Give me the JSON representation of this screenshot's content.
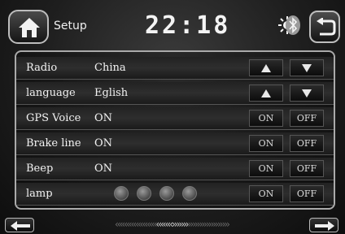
{
  "header": {
    "title": "Setup",
    "clock": "22:18",
    "icons": [
      "home-icon",
      "sun-icon",
      "bluetooth-icon",
      "back-icon"
    ]
  },
  "settings": {
    "rows": [
      {
        "label": "Radio",
        "value": "China",
        "control": "arrows"
      },
      {
        "label": "language",
        "value": "Eglish",
        "control": "arrows"
      },
      {
        "label": "GPS Voice",
        "value": "ON",
        "on_label": "ON",
        "off_label": "OFF"
      },
      {
        "label": "Brake line",
        "value": "ON",
        "on_label": "ON",
        "off_label": "OFF"
      },
      {
        "label": "Beep",
        "value": "ON",
        "on_label": "ON",
        "off_label": "OFF"
      },
      {
        "label": "lamp",
        "value": "",
        "on_label": "ON",
        "off_label": "OFF",
        "lamp_dots": 4
      }
    ]
  },
  "footer": {
    "scroll_left": "‹‹‹‹‹‹‹‹‹‹‹‹‹‹‹‹‹‹",
    "scroll_left_hi": "‹‹‹‹‹‹‹",
    "scroll_right_hi": "›››››››",
    "scroll_right": "››››››››››››››››››",
    "icons": [
      "left-arrow-icon",
      "right-arrow-icon"
    ]
  }
}
